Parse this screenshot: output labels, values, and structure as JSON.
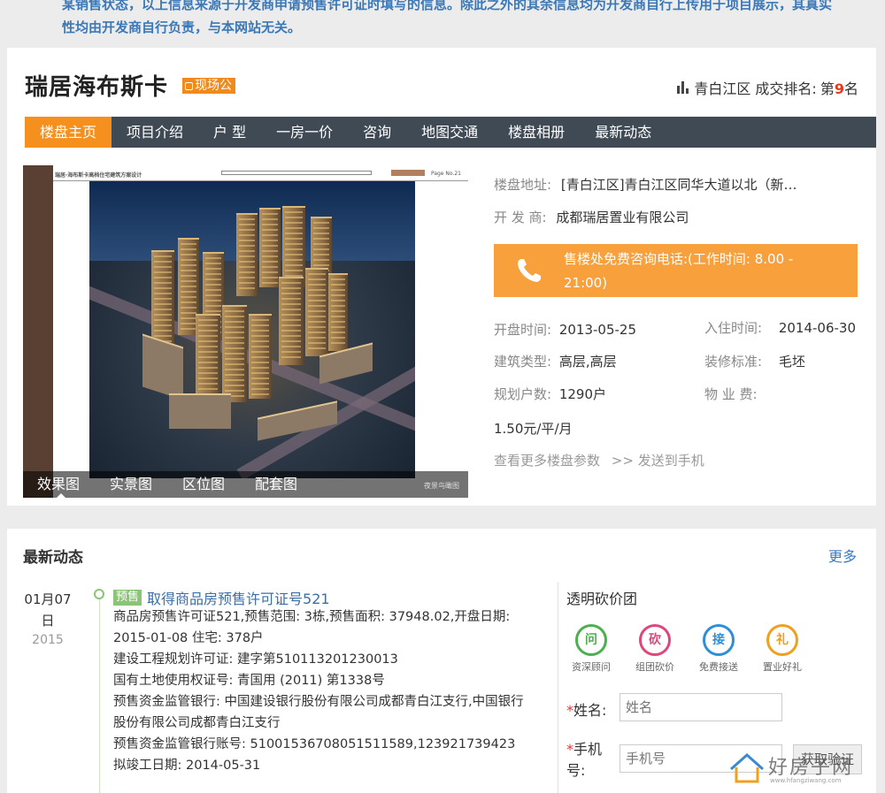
{
  "notice": "某销售状态，以上信息来源于开发商申请预售许可证时填写的信息。除此之外的其余信息均为开发商自行上传用于项目展示，其真实性均由开发商自行负责，与本网站无关。",
  "project": {
    "name": "瑞居海布斯卡",
    "badge": "现场公",
    "rank_prefix": "青白江区 成交排名:",
    "rank_pre2": "第",
    "rank_num": "9",
    "rank_suffix": "名"
  },
  "nav": [
    "楼盘主页",
    "项目介绍",
    "户 型",
    "一房一价",
    "咨询",
    "地图交通",
    "楼盘相册",
    "最新动态"
  ],
  "gallery": {
    "header_title": "瑞居·海布斯卡高档住宅建筑方案设计",
    "header_page": "Page No.21",
    "tabs": [
      "效果图",
      "实景图",
      "区位图",
      "配套图"
    ],
    "credit": "夜景鸟瞰图"
  },
  "info": {
    "address_label": "楼盘地址:",
    "address": "[青白江区]青白江区同华大道以北（新…",
    "developer_label": "开 发 商:",
    "developer": "成都瑞居置业有限公司",
    "phone_text": "售楼处免费咨询电话:(工作时间: 8.00 - 21:00)",
    "open_label": "开盘时间:",
    "open_date": "2013-05-25",
    "checkin_label": "入住时间:",
    "checkin_date": "2014-06-30",
    "type_label": "建筑类型:",
    "type": "高层,高层",
    "decor_label": "装修标准:",
    "decor": "毛坯",
    "households_label": "规划户数:",
    "households": "1290户",
    "fee_label": "物 业 费:",
    "fee": "1.50元/平/月",
    "more_params": "查看更多楼盘参数",
    "send_phone": ">> 发送到手机"
  },
  "news": {
    "section_title": "最新动态",
    "more": "更多",
    "date_md": "01月07日",
    "year": "2015",
    "tag": "预售",
    "headline": "取得商品房预售许可证号521",
    "body": [
      "商品房预售许可证521,预售范围: 3栋,预售面积: 37948.02,开盘日期: 2015-01-08 住宅: 378户",
      "建设工程规划许可证: 建字第510113201230013",
      "国有土地使用权证号: 青国用 (2011) 第1338号",
      "预售资金监管银行: 中国建设银行股份有限公司成都青白江支行,中国银行股份有限公司成都青白江支行",
      "预售资金监管银行账号: 51001536708051511589,123921739423",
      "拟竣工日期: 2014-05-31"
    ]
  },
  "sidebar": {
    "title": "透明砍价团",
    "features": [
      {
        "glyph": "问",
        "label": "资深顾问",
        "color": "#4caf50"
      },
      {
        "glyph": "砍",
        "label": "组团砍价",
        "color": "#e0457b"
      },
      {
        "glyph": "接",
        "label": "免费接送",
        "color": "#2e8fd6"
      },
      {
        "glyph": "礼",
        "label": "置业好礼",
        "color": "#f0a020"
      }
    ],
    "name_label": "姓名:",
    "name_placeholder": "姓名",
    "phone_label": "手机号:",
    "phone_placeholder": "手机号",
    "code_button": "获取验证"
  },
  "watermark": {
    "text": "好房子网",
    "sub": "www.hfangziwang.com"
  }
}
